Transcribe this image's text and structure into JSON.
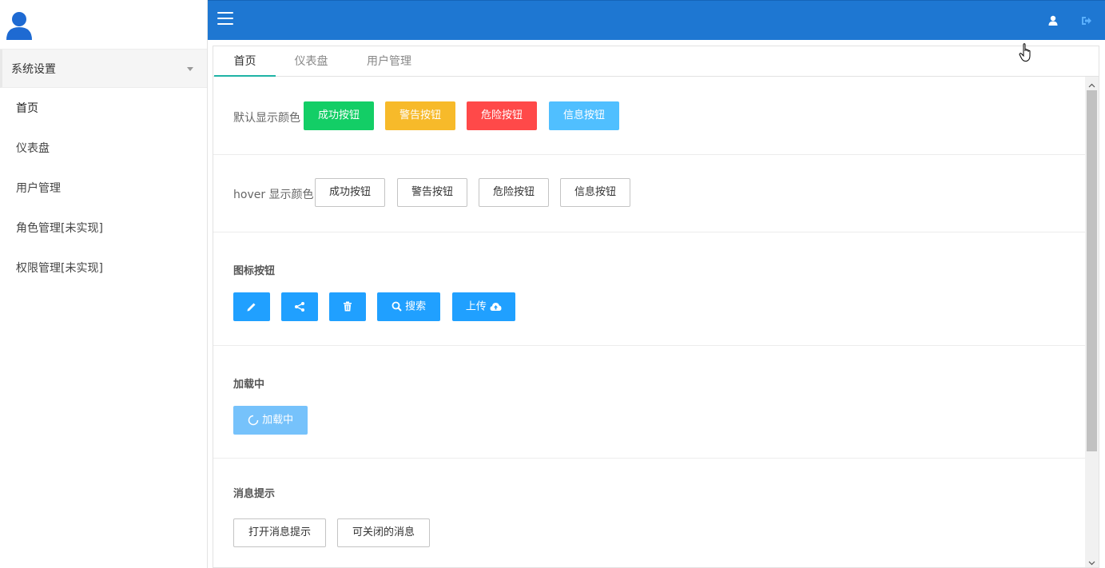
{
  "sidebar": {
    "group_label": "系统设置",
    "items": [
      {
        "label": "首页"
      },
      {
        "label": "仪表盘"
      },
      {
        "label": "用户管理"
      },
      {
        "label": "角色管理[未实现]"
      },
      {
        "label": "权限管理[未实现]"
      }
    ]
  },
  "tabs": [
    {
      "label": "首页"
    },
    {
      "label": "仪表盘"
    },
    {
      "label": "用户管理"
    }
  ],
  "sections": {
    "default_colors": {
      "label": "默认显示颜色",
      "buttons": [
        "成功按钮",
        "警告按钮",
        "危险按钮",
        "信息按钮"
      ]
    },
    "hover_colors": {
      "label": "hover 显示颜色",
      "buttons": [
        "成功按钮",
        "警告按钮",
        "危险按钮",
        "信息按钮"
      ]
    },
    "icon_buttons": {
      "title": "图标按钮",
      "search_label": "搜索",
      "upload_label": "上传"
    },
    "loading": {
      "title": "加载中",
      "button_label": "加载中"
    },
    "message": {
      "title": "消息提示",
      "open_label": "打开消息提示",
      "closable_label": "可关闭的消息"
    }
  },
  "colors": {
    "topbar": "#1e77d2",
    "success": "#13ce66",
    "warning": "#f7ba2a",
    "danger": "#ff4949",
    "info": "#50bfff",
    "primary": "#20a0ff",
    "tab_active_underline": "#1eb3a5"
  },
  "icons": {
    "avatar": "user-avatar-icon",
    "menu": "hamburger-icon",
    "top_user": "user-icon",
    "logout": "logout-icon",
    "edit": "pencil-icon",
    "share": "share-icon",
    "delete": "trash-icon",
    "search": "search-icon",
    "upload": "cloud-upload-icon",
    "loading": "spinner-icon"
  }
}
